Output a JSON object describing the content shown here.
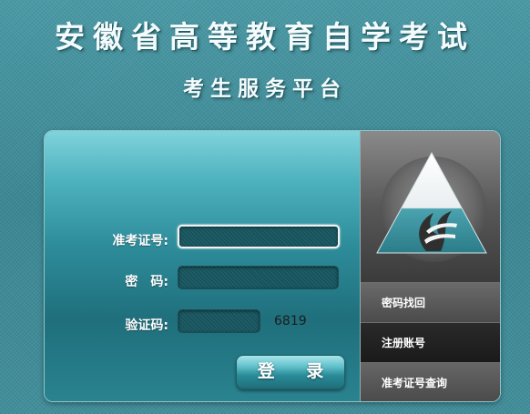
{
  "header": {
    "title": "安徽省高等教育自学考试",
    "subtitle": "考生服务平台"
  },
  "login": {
    "exam_id_label": "准考证号:",
    "password_label": "密　码:",
    "captcha_label": "验证码:",
    "exam_id_value": "",
    "password_value": "",
    "captcha_value": "",
    "captcha_code": "6819",
    "submit_label": "登 录"
  },
  "sidebar": {
    "items": [
      {
        "label": "密码找回"
      },
      {
        "label": "注册账号"
      },
      {
        "label": "准考证号查询"
      }
    ]
  },
  "icons": {
    "logo": "triangle-flame-logo-icon"
  },
  "colors": {
    "background": "#3f8e9a",
    "panel_top": "#7fd3dc",
    "panel_bottom": "#1f6f7c",
    "sidebar": "#4a4a4a",
    "button": "#2a8b98"
  }
}
